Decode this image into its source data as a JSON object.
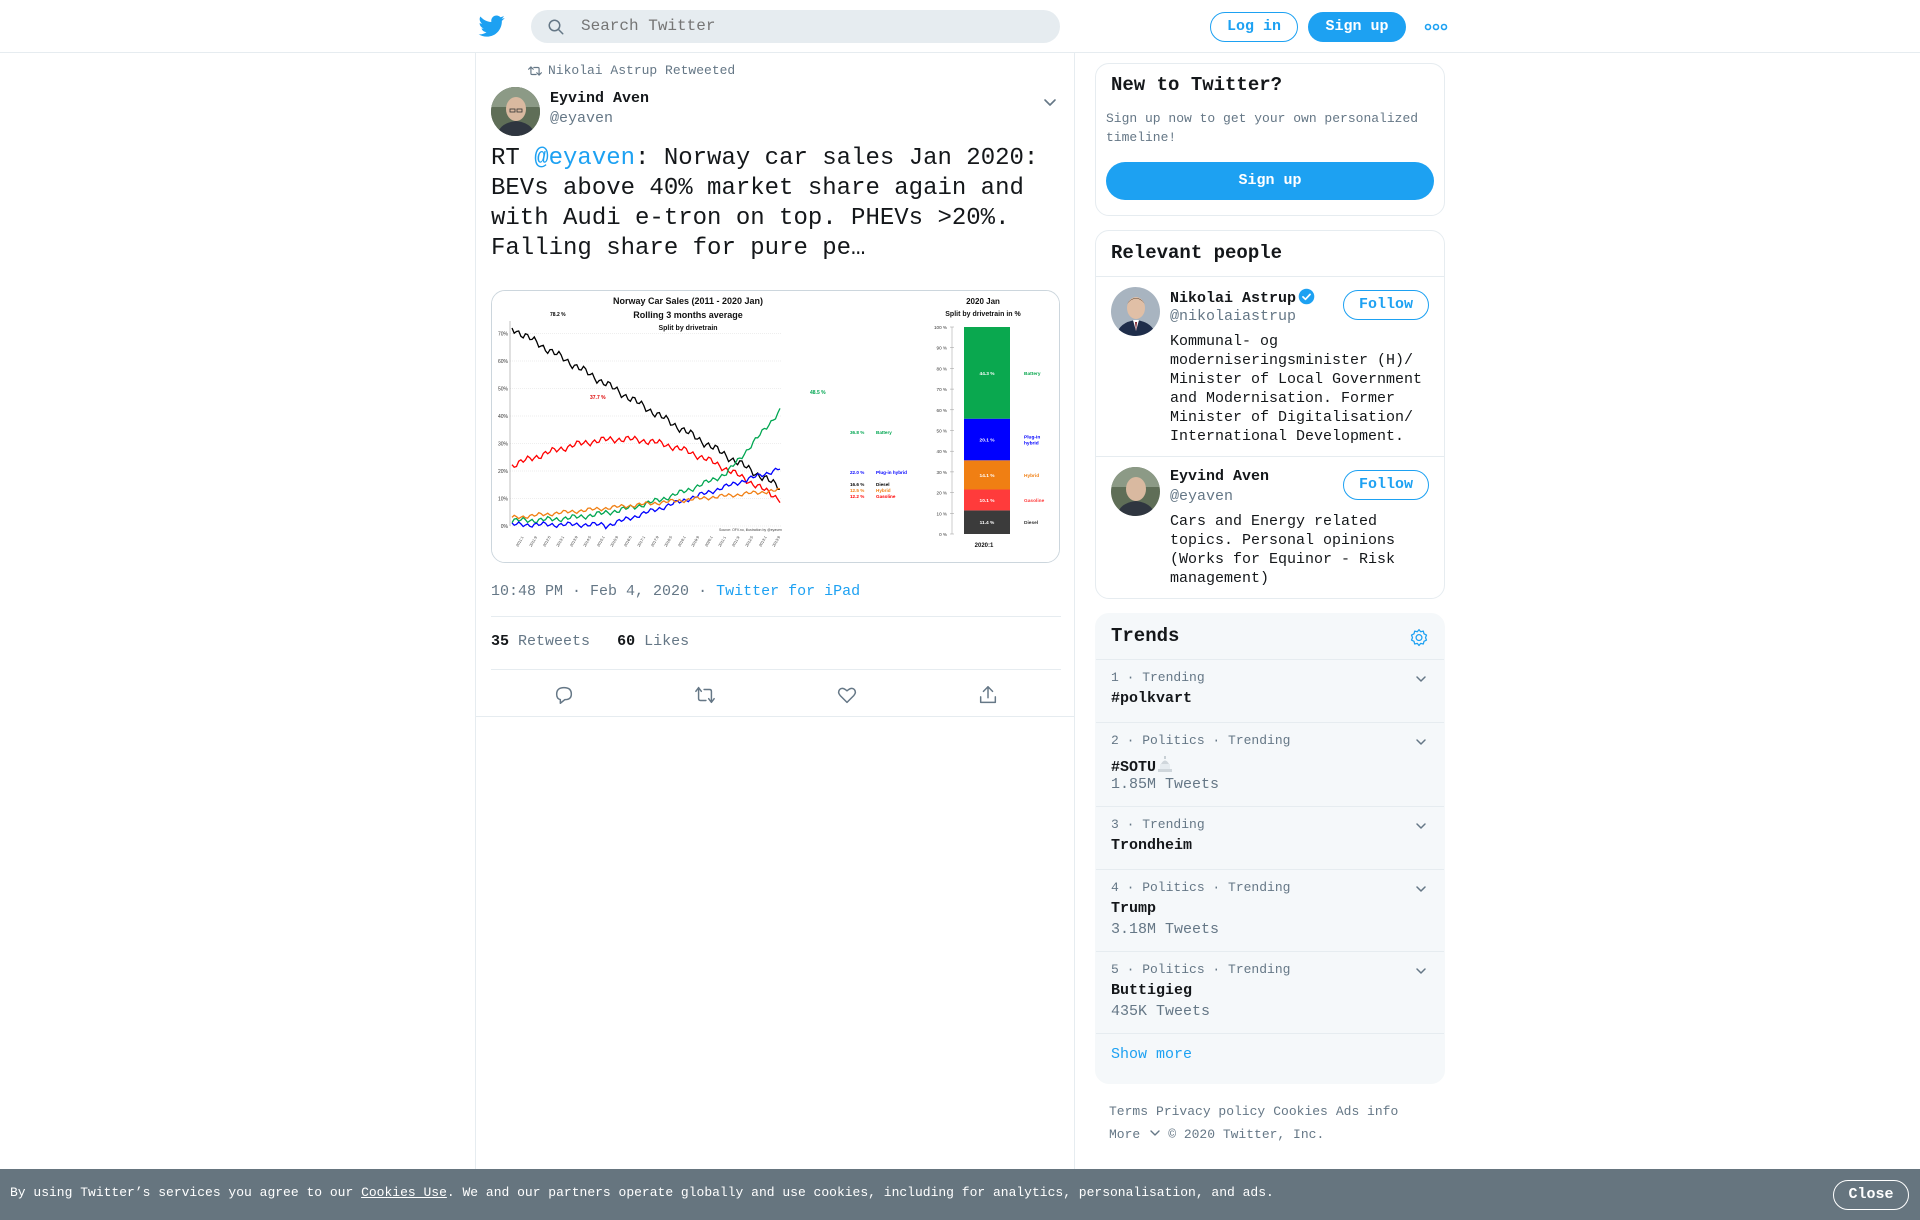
{
  "topbar": {
    "search_placeholder": "Search Twitter",
    "login_label": "Log in",
    "signup_label": "Sign up"
  },
  "tweet": {
    "retweeted_by": "Nikolai Astrup Retweeted",
    "author_name": "Eyvind Aven",
    "author_handle": "@eyaven",
    "text_prefix": "RT ",
    "text_mention": "@eyaven",
    "text_body": ": Norway car sales Jan 2020: BEVs above 40% market share again and with Audi e-tron on top. PHEVs >20%. Falling share for pure pe…",
    "time": "10:48 PM · Feb 4, 2020",
    "separator": "·",
    "source": "Twitter for iPad",
    "retweets_count": "35",
    "retweets_label": "Retweets",
    "likes_count": "60",
    "likes_label": "Likes"
  },
  "media_chart": {
    "left_title_1": "Norway Car Sales (2011 - 2020 Jan)",
    "left_title_2": "Rolling 3 months average",
    "left_title_3": "Split by drivetrain",
    "right_title_1": "2020 Jan",
    "right_title_2": "Split by drivetrain in %",
    "source_note": "Source: OFV.no, illustration by @eyaven",
    "bar_xlabel": "2020:1",
    "line_annotations": {
      "peak_black": "78.2 %",
      "peak_red": "37.7 %",
      "peak_green": "48.5 %"
    },
    "line_end_labels": [
      {
        "value": "36.8 %",
        "name": "Battery"
      },
      {
        "value": "22.0 %",
        "name": "Plug-in hybrid"
      },
      {
        "value": "16.6 %",
        "name": "Diesel"
      },
      {
        "value": "12.5 %",
        "name": "Hybrid"
      },
      {
        "value": "12.2 %",
        "name": "Gasoline"
      }
    ],
    "stack": [
      {
        "name": "Battery",
        "value_label": "44.3 %",
        "value": 44.3,
        "color": "#0aa84f"
      },
      {
        "name": "Plug-in hybrid",
        "value_label": "20.1 %",
        "value": 20.1,
        "color": "#0000ff"
      },
      {
        "name": "Hybrid",
        "value_label": "14.1 %",
        "value": 14.1,
        "color": "#f07f13"
      },
      {
        "name": "Gasoline",
        "value_label": "10.1 %",
        "value": 10.1,
        "color": "#ff3b3b"
      },
      {
        "name": "Diesel",
        "value_label": "11.4 %",
        "value": 11.4,
        "color": "#3b3b3b"
      }
    ]
  },
  "sidebar": {
    "new_title": "New to Twitter?",
    "new_desc": "Sign up now to get your own personalized timeline!",
    "new_button": "Sign up",
    "people_title": "Relevant people",
    "people": [
      {
        "name": "Nikolai Astrup",
        "handle": "@nikolaiastrup",
        "bio": "Kommunal- og moderniseringsminister (H)/ Minister of Local Government and Modernisation. Former Minister of Digitalisation/ International Development.",
        "follow": "Follow"
      },
      {
        "name": "Eyvind Aven",
        "handle": "@eyaven",
        "bio": "Cars and Energy related topics. Personal opinions (Works for Equinor - Risk management)",
        "follow": "Follow"
      }
    ],
    "trends_title": "Trends",
    "trends": [
      {
        "context": "1 · Trending",
        "name": "#polkvart",
        "count": ""
      },
      {
        "context": "2 · Politics · Trending",
        "name": "#SOTU",
        "count": "1.85M Tweets"
      },
      {
        "context": "3 · Trending",
        "name": "Trondheim",
        "count": ""
      },
      {
        "context": "4 · Politics · Trending",
        "name": "Trump",
        "count": "3.18M Tweets"
      },
      {
        "context": "5 · Politics · Trending",
        "name": "Buttigieg",
        "count": "435K Tweets"
      }
    ],
    "show_more": "Show more"
  },
  "footer": {
    "links": [
      "Terms",
      "Privacy policy",
      "Cookies",
      "Ads info"
    ],
    "more": "More",
    "copyright": "© 2020 Twitter, Inc."
  },
  "cookie": {
    "text_before": "By using Twitter’s services you agree to our ",
    "link": "Cookies Use",
    "text_after": ". We and our partners operate globally and use cookies, including for analytics, personalisation, and ads.",
    "close": "Close"
  },
  "colors": {
    "accent": "#1da1f2",
    "muted": "#657786",
    "border": "#e6ecf0",
    "cookie_bg": "#66757f"
  }
}
